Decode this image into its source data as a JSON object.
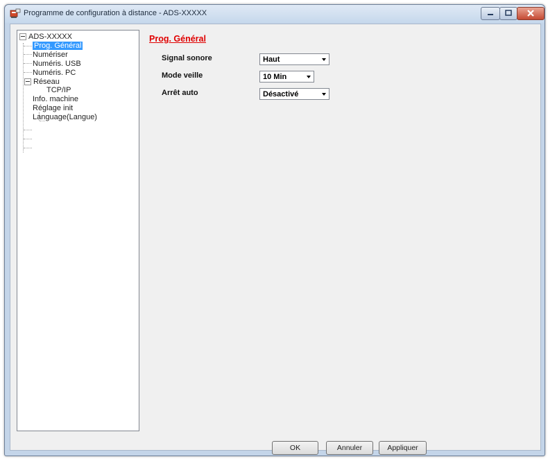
{
  "window": {
    "title": "Programme de configuration à distance - ADS-XXXXX"
  },
  "tree": {
    "root": "ADS-XXXXX",
    "items": [
      {
        "label": "Prog. Général",
        "selected": true
      },
      {
        "label": "Numériser"
      },
      {
        "label": "Numéris. USB"
      },
      {
        "label": "Numéris. PC"
      },
      {
        "label": "Réseau",
        "children": [
          "TCP/IP"
        ]
      },
      {
        "label": "Info. machine"
      },
      {
        "label": "Réglage init"
      },
      {
        "label": "Language(Langue)"
      }
    ]
  },
  "panel": {
    "title": "Prog. Général",
    "fields": [
      {
        "label": "Signal sonore",
        "value": "Haut"
      },
      {
        "label": "Mode veille",
        "value": "10 Min"
      },
      {
        "label": "Arrêt auto",
        "value": "Désactivé"
      }
    ]
  },
  "buttons": {
    "ok": "OK",
    "cancel": "Annuler",
    "apply": "Appliquer"
  },
  "icons": {
    "app": "remote-setup-icon",
    "minimize": "minimize-icon",
    "maximize": "maximize-icon",
    "close": "close-icon"
  },
  "colors": {
    "selection": "#3399ff",
    "section_title": "#e00000",
    "close_button": "#c54a33"
  }
}
